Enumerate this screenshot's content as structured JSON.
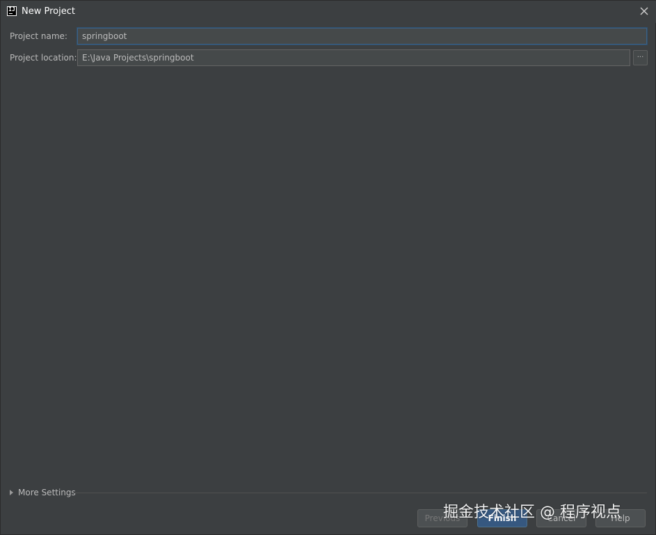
{
  "window": {
    "title": "New Project",
    "app_icon": "intellij-idea-icon",
    "close_icon": "close-icon"
  },
  "form": {
    "project_name_label": "Project name:",
    "project_name_value": "springboot",
    "project_location_label": "Project location:",
    "project_location_value": "E:\\Java Projects\\springboot",
    "browse_label": "..."
  },
  "more_settings": {
    "label": "More Settings",
    "expanded": false
  },
  "buttons": {
    "previous": "Previous",
    "finish": "Finish",
    "cancel": "Cancel",
    "help": "Help"
  },
  "watermark": {
    "text": "掘金技术社区 @ 程序视点"
  },
  "colors": {
    "background": "#3c3f41",
    "field": "#45494a",
    "focus_border": "#3d6185",
    "default_button": "#365880"
  }
}
